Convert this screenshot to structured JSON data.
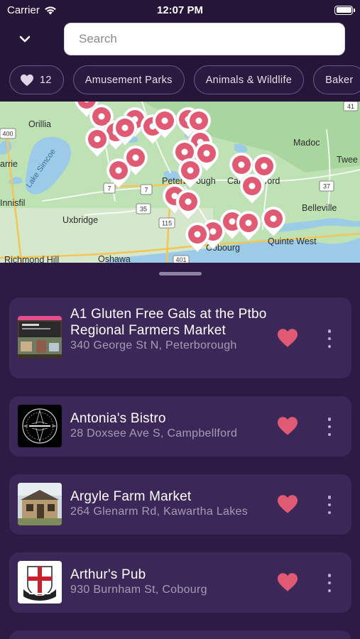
{
  "status_bar": {
    "carrier": "Carrier",
    "time": "12:07 PM",
    "wifi_icon": "wifi-icon",
    "battery_icon": "battery-icon"
  },
  "header": {
    "collapse_icon": "chevron-down-icon",
    "search": {
      "placeholder": "Search",
      "value": ""
    },
    "favorites_chip": {
      "icon": "heart-icon",
      "count": "12"
    },
    "category_chips": [
      "Amusement Parks",
      "Animals & Wildlife",
      "Baker"
    ]
  },
  "map": {
    "labels": {
      "orillia": "Orillia",
      "lake_simcoe": "Lake Simcoe",
      "barrie": "arrie",
      "innisfil": "Innisfil",
      "uxbridge": "Uxbridge",
      "oshawa": "Oshawa",
      "richmond_hill": "Richmond Hill",
      "peterborough": "Peterborough",
      "campbellford": "Campbellford",
      "madoc": "Madoc",
      "tweed": "Twee",
      "belleville": "Belleville",
      "quinte_west": "Quinte West",
      "cobourg": "Cobourg"
    },
    "road_shields": [
      "400",
      "41",
      "7",
      "7",
      "35",
      "115",
      "37",
      "401"
    ],
    "pin_color": "#e05a73",
    "marker_icon": "map-pin-icon"
  },
  "listings": [
    {
      "name": "A1 Gluten Free Gals at the Ptbo Regional Farmers Market",
      "address": "340 George St N, Peterborough",
      "favorited": true
    },
    {
      "name": "Antonia's Bistro",
      "address": "28 Doxsee Ave S, Campbellford",
      "favorited": true
    },
    {
      "name": "Argyle Farm Market",
      "address": "264 Glenarm Rd, Kawartha Lakes",
      "favorited": true
    },
    {
      "name": "Arthur's Pub",
      "address": "930 Burnham St, Cobourg",
      "favorited": true
    }
  ],
  "colors": {
    "background": "#2d1b46",
    "header": "#241539",
    "card": "#3b2858",
    "heart": "#e05a73",
    "address_text": "#a59cb5"
  }
}
